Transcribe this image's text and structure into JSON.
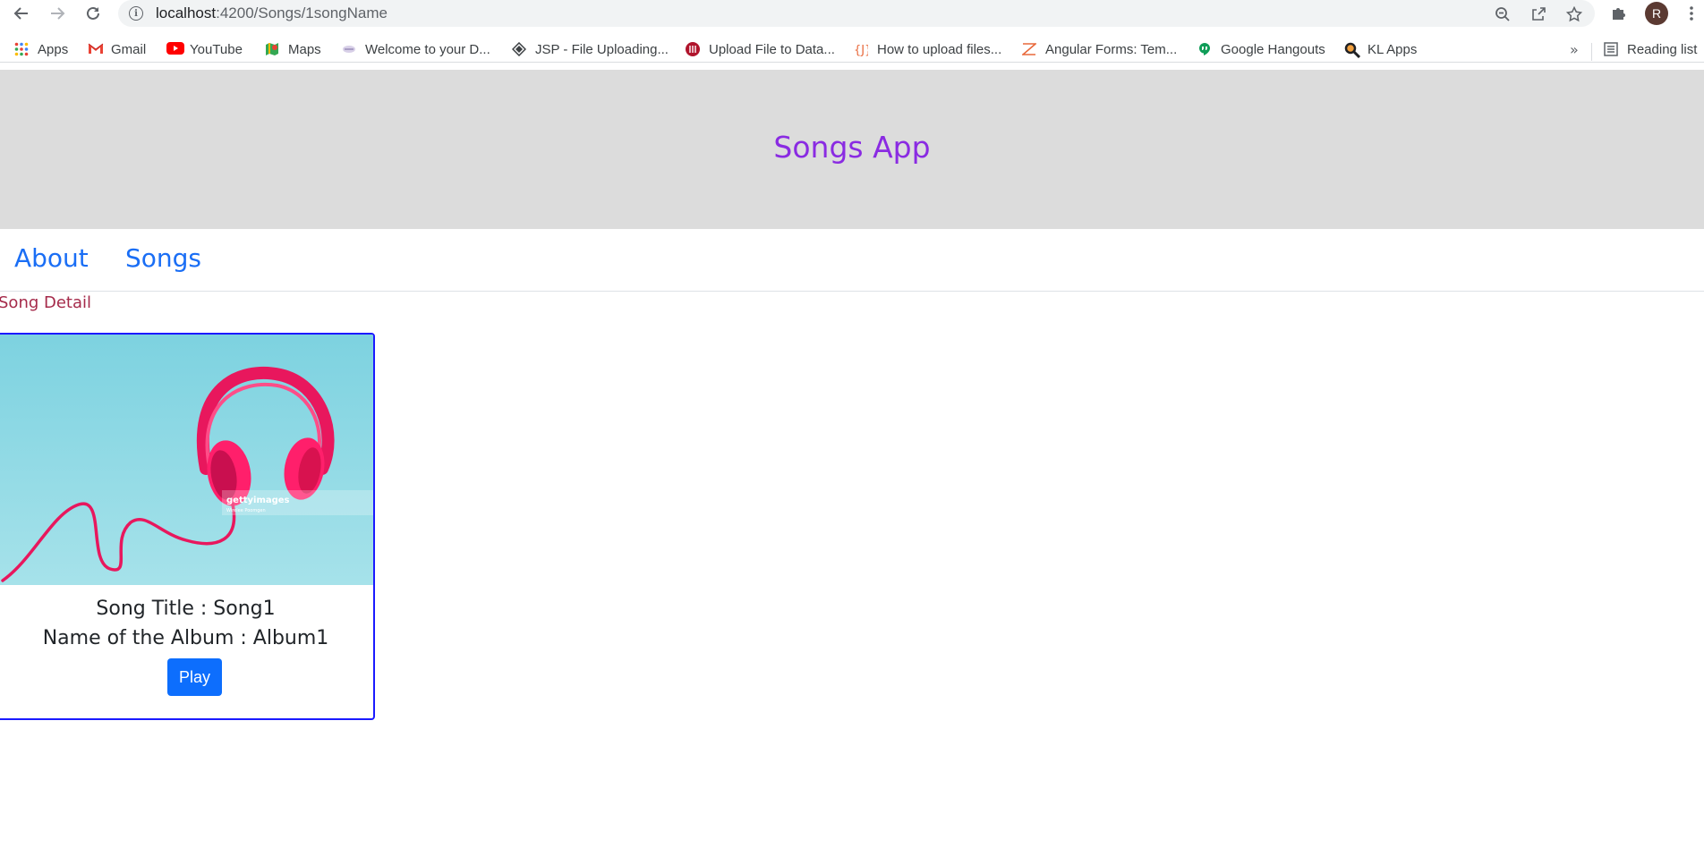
{
  "browser": {
    "url_host": "localhost",
    "url_path": ":4200/Songs/1songName",
    "avatar_letter": "R",
    "bookmarks": [
      {
        "label": "Apps",
        "icon": "apps-grid-icon"
      },
      {
        "label": "Gmail",
        "icon": "gmail-icon"
      },
      {
        "label": "YouTube",
        "icon": "youtube-icon"
      },
      {
        "label": "Maps",
        "icon": "maps-icon"
      },
      {
        "label": "Welcome to your D...",
        "icon": "site-icon"
      },
      {
        "label": "JSP - File Uploading...",
        "icon": "site-icon"
      },
      {
        "label": "Upload File to Data...",
        "icon": "site-icon"
      },
      {
        "label": "How to upload files...",
        "icon": "site-icon"
      },
      {
        "label": "Angular Forms: Tem...",
        "icon": "site-icon"
      },
      {
        "label": "Google Hangouts",
        "icon": "hangouts-icon"
      },
      {
        "label": "KL Apps",
        "icon": "search-icon"
      }
    ],
    "more_label": "»",
    "reading_list_label": "Reading list"
  },
  "app": {
    "title": "Songs App",
    "nav": [
      {
        "label": "About"
      },
      {
        "label": "Songs"
      }
    ],
    "section_title": "Song Detail",
    "song": {
      "title_line": "Song Title : Song1",
      "album_line": "Name of the Album : Album1",
      "play_label": "Play",
      "image_watermark": "gettyimages",
      "image_credit": "Wirelee Poomgen"
    }
  }
}
